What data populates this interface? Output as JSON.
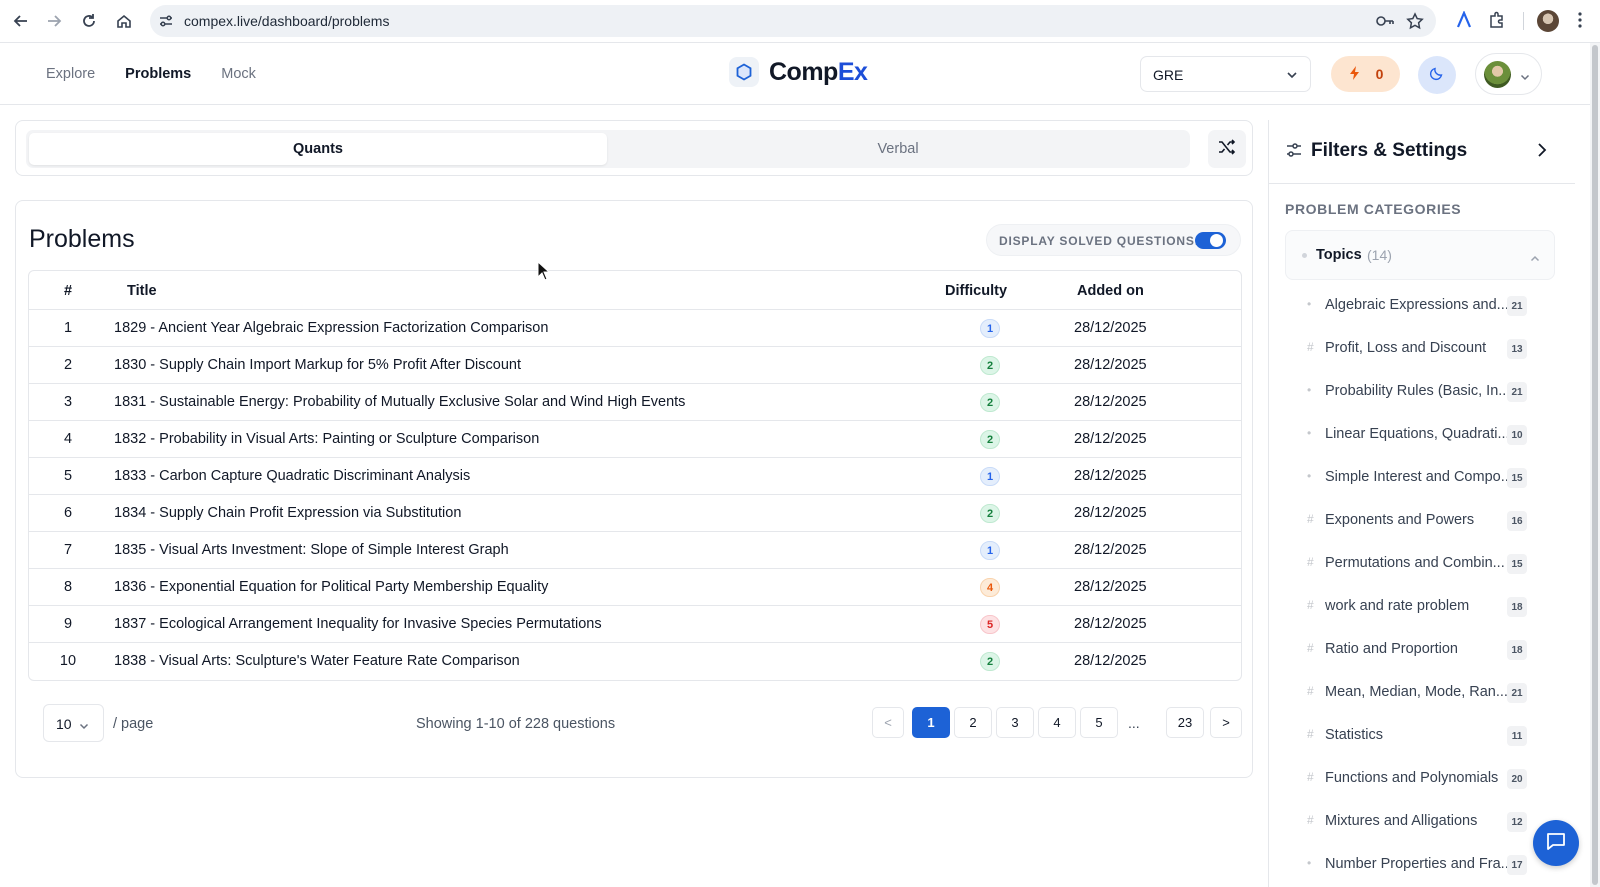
{
  "browser": {
    "url": "compex.live/dashboard/problems"
  },
  "header": {
    "nav": [
      "Explore",
      "Problems",
      "Mock"
    ],
    "active_nav": "Problems",
    "brand_comp": "Comp",
    "brand_ex": "Ex",
    "exam": "GRE",
    "streak": "0"
  },
  "subject_tabs": [
    "Quants",
    "Verbal"
  ],
  "active_tab": "Quants",
  "problems": {
    "title": "Problems",
    "solved_toggle_label": "DISPLAY SOLVED QUESTIONS:",
    "solved_toggle_on": true,
    "columns": [
      "#",
      "Title",
      "Difficulty",
      "Added on"
    ],
    "rows": [
      {
        "num": "1",
        "title": "1829 - Ancient Year Algebraic Expression Factorization Comparison",
        "difficulty": "1",
        "added": "28/12/2025"
      },
      {
        "num": "2",
        "title": "1830 - Supply Chain Import Markup for 5% Profit After Discount",
        "difficulty": "2",
        "added": "28/12/2025"
      },
      {
        "num": "3",
        "title": "1831 - Sustainable Energy: Probability of Mutually Exclusive Solar and Wind High Events",
        "difficulty": "2",
        "added": "28/12/2025"
      },
      {
        "num": "4",
        "title": "1832 - Probability in Visual Arts: Painting or Sculpture Comparison",
        "difficulty": "2",
        "added": "28/12/2025"
      },
      {
        "num": "5",
        "title": "1833 - Carbon Capture Quadratic Discriminant Analysis",
        "difficulty": "1",
        "added": "28/12/2025"
      },
      {
        "num": "6",
        "title": "1834 - Supply Chain Profit Expression via Substitution",
        "difficulty": "2",
        "added": "28/12/2025"
      },
      {
        "num": "7",
        "title": "1835 - Visual Arts Investment: Slope of Simple Interest Graph",
        "difficulty": "1",
        "added": "28/12/2025"
      },
      {
        "num": "8",
        "title": "1836 - Exponential Equation for Political Party Membership Equality",
        "difficulty": "4",
        "added": "28/12/2025"
      },
      {
        "num": "9",
        "title": "1837 - Ecological Arrangement Inequality for Invasive Species Permutations",
        "difficulty": "5",
        "added": "28/12/2025"
      },
      {
        "num": "10",
        "title": "1838 - Visual Arts: Sculpture's Water Feature Rate Comparison",
        "difficulty": "2",
        "added": "28/12/2025"
      }
    ],
    "page_size": "10",
    "per_page_label": "/ page",
    "showing": "Showing 1-10 of 228 questions",
    "pager": {
      "prev": "<",
      "pages": [
        "1",
        "2",
        "3",
        "4",
        "5"
      ],
      "ellipsis": "...",
      "last": "23",
      "next": ">",
      "current": "1"
    }
  },
  "sidebar": {
    "title": "Filters & Settings",
    "section": "PROBLEM CATEGORIES",
    "group_label": "Topics",
    "group_count": "(14)",
    "topics": [
      {
        "name": "Algebraic Expressions and...",
        "count": "21",
        "marker": "•"
      },
      {
        "name": "Profit, Loss and Discount",
        "count": "13",
        "marker": "#"
      },
      {
        "name": "Probability Rules (Basic, In...",
        "count": "21",
        "marker": "•"
      },
      {
        "name": "Linear Equations, Quadrati...",
        "count": "10",
        "marker": "•"
      },
      {
        "name": "Simple Interest and Compo...",
        "count": "15",
        "marker": "•"
      },
      {
        "name": "Exponents and Powers",
        "count": "16",
        "marker": "#"
      },
      {
        "name": "Permutations and Combin...",
        "count": "15",
        "marker": "#"
      },
      {
        "name": "work and rate problem",
        "count": "18",
        "marker": "#"
      },
      {
        "name": "Ratio and Proportion",
        "count": "18",
        "marker": "#"
      },
      {
        "name": "Mean, Median, Mode, Ran...",
        "count": "21",
        "marker": "#"
      },
      {
        "name": "Statistics",
        "count": "11",
        "marker": "#"
      },
      {
        "name": "Functions and Polynomials",
        "count": "20",
        "marker": "#"
      },
      {
        "name": "Mixtures and Alligations",
        "count": "12",
        "marker": "#"
      },
      {
        "name": "Number Properties and Fra...",
        "count": "17",
        "marker": "•"
      }
    ]
  },
  "colors": {
    "accent": "#1d62d6",
    "brand_ex": "#1d4ed8",
    "streak_bg": "#fde5d0"
  }
}
